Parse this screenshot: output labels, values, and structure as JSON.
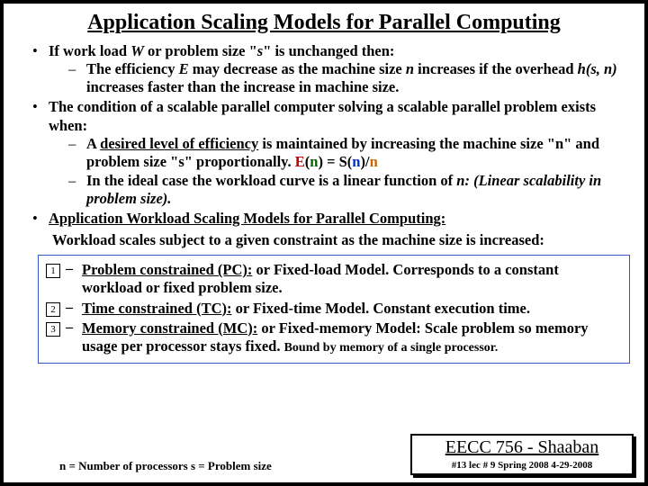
{
  "title": "Application Scaling Models for Parallel Computing",
  "bullets": {
    "b1_pre": "If work load  ",
    "b1_W": "W",
    "b1_mid": "  or problem size  \"",
    "b1_s": "s",
    "b1_post": "\"  is unchanged then:",
    "b1s_pre": "The efficiency  ",
    "b1s_E": "E",
    "b1s_mid": "  may decrease as the machine size ",
    "b1s_n": "n",
    "b1s_mid2": " increases if the overhead  ",
    "b1s_h": "h(s, n)",
    "b1s_post": "  increases faster than the increase in machine size.",
    "b2": "The condition of a scalable parallel computer solving a scalable parallel problem exists when:",
    "b2s1_pre": "A ",
    "b2s1_u": "desired level of efficiency",
    "b2s1_mid": " is maintained by increasing the machine size \"n\" and problem size \"s\" proportionally.  ",
    "b2s1_E": "E",
    "b2s1_paren1": "(",
    "b2s1_n1": "n",
    "b2s1_eq": ")  =  S(",
    "b2s1_n2": "n",
    "b2s1_slash": ")/",
    "b2s1_n3": "n",
    "b2s2_pre": "In the ideal case the workload curve is a linear function of ",
    "b2s2_n": "n:",
    "b2s2_post": " (Linear scalability in problem size).",
    "b3": "Application Workload Scaling Models for Parallel Computing:"
  },
  "subhead": "Workload scales subject to a given constraint as the machine size is increased:",
  "models": {
    "n1": "1",
    "m1_u": "Problem constrained (PC):",
    "m1_t": "  or Fixed-load Model.  Corresponds to a constant workload or fixed problem size.",
    "n2": "2",
    "m2_u": "Time constrained (TC):",
    "m2_t": "  or Fixed-time Model.  Constant execution time.",
    "n3": "3",
    "m3_u": "Memory constrained (MC):",
    "m3_t": "  or Fixed-memory Model:  Scale problem so memory usage per processor stays fixed.  ",
    "m3_small": "Bound  by memory of a single processor."
  },
  "legend": "n = Number of processors        s = Problem size",
  "footer": {
    "course": "EECC 756 - Shaaban",
    "note": "#13   lec # 9   Spring 2008  4-29-2008"
  }
}
